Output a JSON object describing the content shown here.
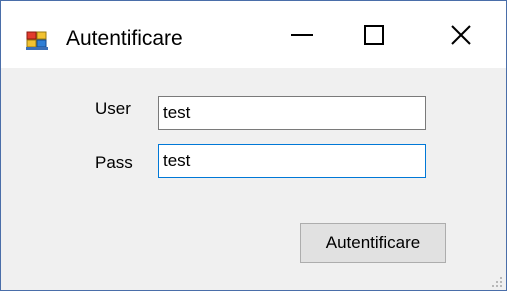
{
  "window": {
    "title": "Autentificare",
    "icon": "winforms-app-icon",
    "controls": {
      "minimize_icon": "minimize-icon",
      "maximize_icon": "maximize-icon",
      "close_icon": "close-icon"
    }
  },
  "form": {
    "user_label": "User",
    "user_value": "test",
    "pass_label": "Pass",
    "pass_value": "test",
    "submit_label": "Autentificare"
  },
  "colors": {
    "window_border": "#4a6ea9",
    "client_background": "#f0f0f0",
    "focus_border": "#0078d7",
    "button_background": "#e1e1e1"
  }
}
